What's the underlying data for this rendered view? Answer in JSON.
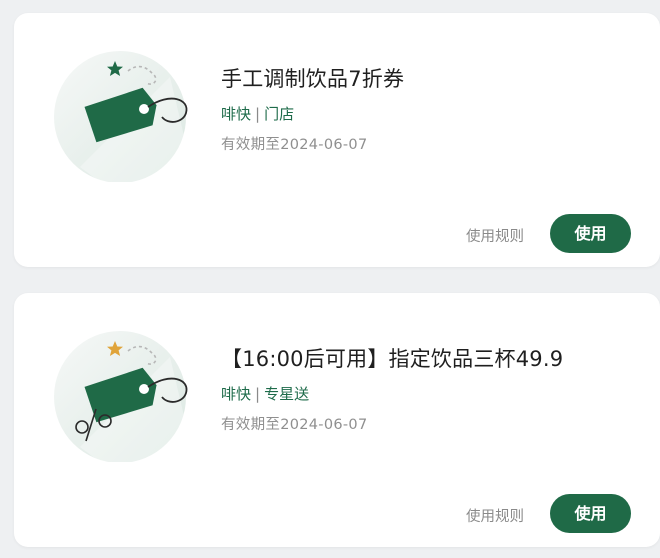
{
  "colors": {
    "page_background": "#eef0f2",
    "card_background": "#ffffff",
    "brand_green": "#1f6a47",
    "muted_text": "#8f8f8f"
  },
  "coupons": [
    {
      "title": "手工调制饮品7折券",
      "brand": "啡快",
      "separator": "|",
      "scope": "门店",
      "expiry": "有效期至2024-06-07",
      "rules_label": "使用规则",
      "use_label": "使用",
      "art_icons": [
        "green-star-icon",
        "price-tag-icon"
      ]
    },
    {
      "title": "【16:00后可用】指定饮品三杯49.9",
      "brand": "啡快",
      "separator": "|",
      "scope": "专星送",
      "expiry": "有效期至2024-06-07",
      "rules_label": "使用规则",
      "use_label": "使用",
      "art_icons": [
        "gold-star-icon",
        "price-tag-icon",
        "percent-icon"
      ]
    }
  ]
}
